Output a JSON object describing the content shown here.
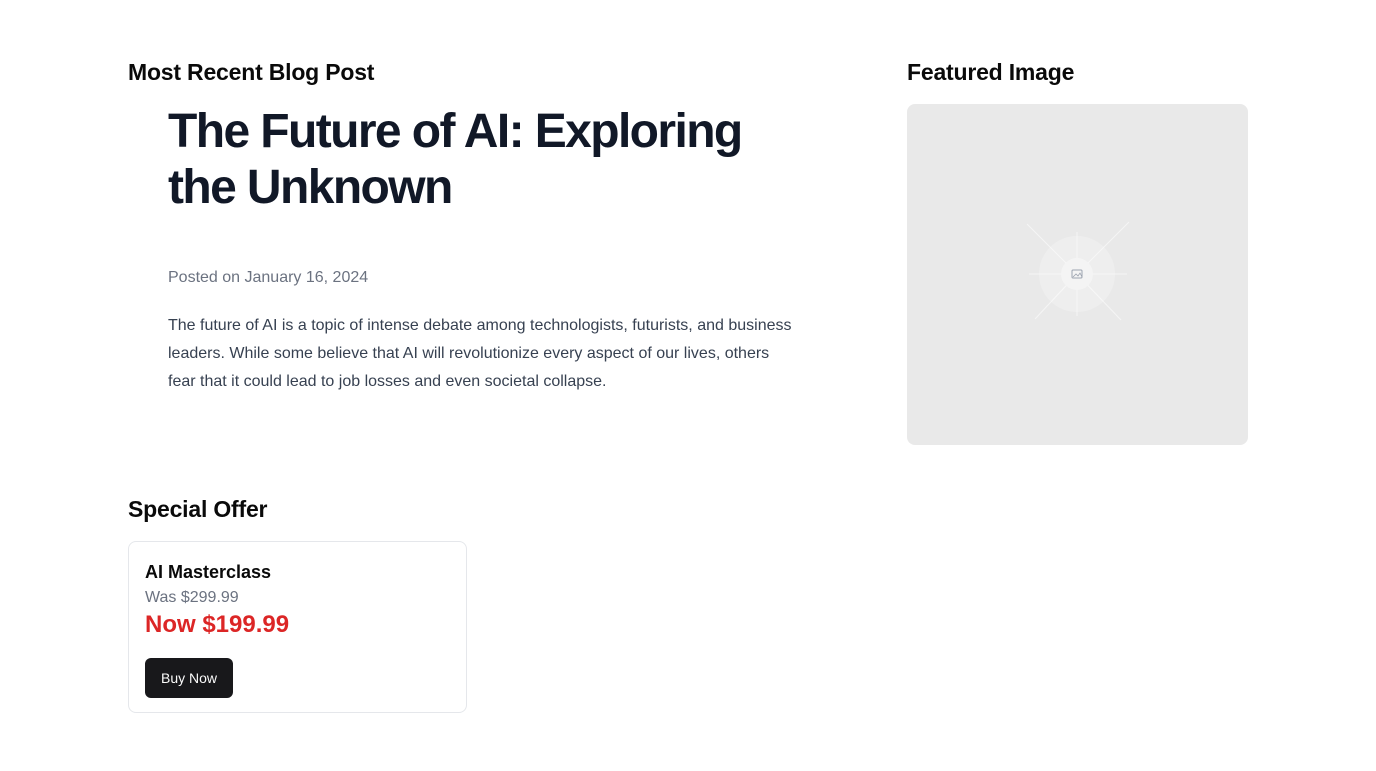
{
  "blog_section": {
    "heading": "Most Recent Blog Post",
    "post": {
      "title": "The Future of AI: Exploring the Unknown",
      "posted_on": "Posted on January 16, 2024",
      "excerpt": "The future of AI is a topic of intense debate among technologists, futurists, and business leaders. While some believe that AI will revolutionize every aspect of our lives, others fear that it could lead to job losses and even societal collapse."
    }
  },
  "featured_section": {
    "heading": "Featured Image",
    "image_icon": "image-placeholder-icon"
  },
  "offer_section": {
    "heading": "Special Offer",
    "card": {
      "title": "AI Masterclass",
      "was_price": "Was $299.99",
      "now_price": "Now $199.99",
      "button_label": "Buy Now"
    }
  },
  "colors": {
    "price_accent": "#dc2626",
    "button_bg": "#18181b",
    "placeholder_bg": "#e9e9e9"
  }
}
